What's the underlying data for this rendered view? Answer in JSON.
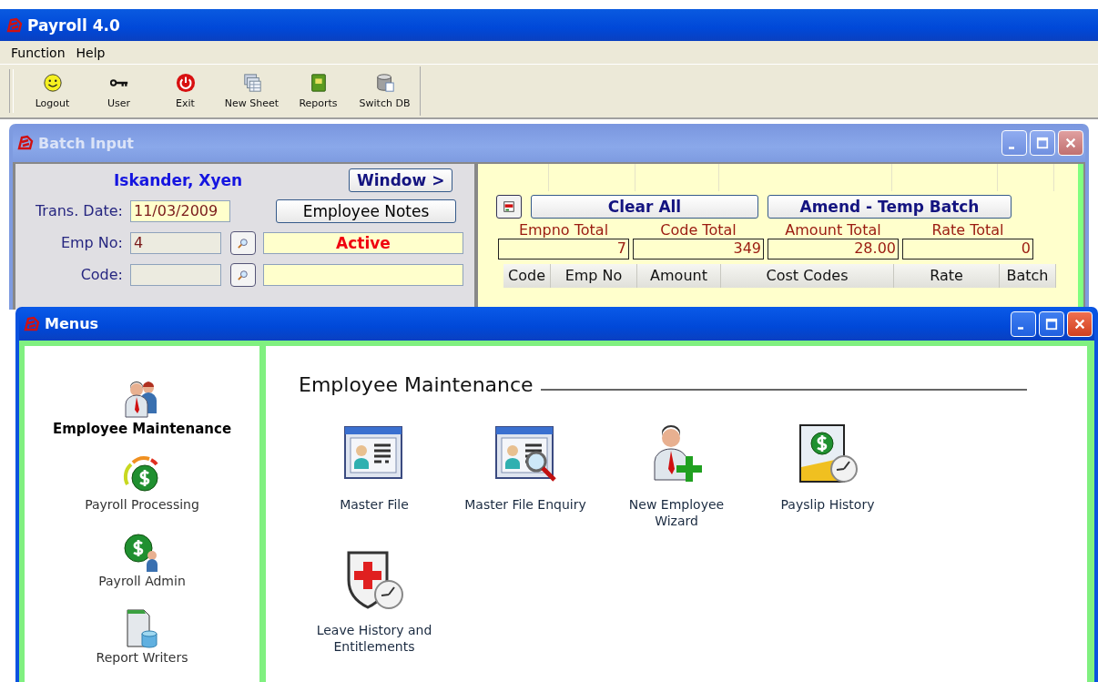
{
  "app": {
    "title": "Payroll 4.0"
  },
  "menu": [
    "Function",
    "Help"
  ],
  "toolbar": [
    {
      "label": "Logout",
      "kind": "smiley"
    },
    {
      "label": "User",
      "kind": "key"
    },
    {
      "label": "Exit",
      "kind": "power"
    },
    {
      "label": "New Sheet",
      "kind": "sheets"
    },
    {
      "label": "Reports",
      "kind": "book"
    },
    {
      "label": "Switch DB",
      "kind": "database"
    }
  ],
  "batch_window": {
    "title": "Batch Input",
    "employee_name": "Iskander, Xyen",
    "window_button": "Window >",
    "notes_button": "Employee Notes",
    "trans_date": {
      "label": "Trans. Date:",
      "value": "11/03/2009"
    },
    "emp_no": {
      "label": "Emp No:",
      "value": "4",
      "status": "Active"
    },
    "code": {
      "label": "Code:"
    },
    "clear_button": "Clear All",
    "amend_button": "Amend - Temp Batch",
    "totals": [
      {
        "label": "Empno Total",
        "value": "7"
      },
      {
        "label": "Code Total",
        "value": "349"
      },
      {
        "label": "Amount Total",
        "value": "28.00"
      },
      {
        "label": "Rate Total",
        "value": "0"
      }
    ],
    "columns": [
      "Code",
      "Emp No",
      "Amount",
      "Cost Codes",
      "Rate",
      "Batch"
    ]
  },
  "menus_window": {
    "title": "Menus",
    "sidebar": [
      {
        "label": "Employee Maintenance",
        "kind": "people",
        "selected": true
      },
      {
        "label": "Payroll Processing",
        "kind": "dollar-gauge",
        "selected": false
      },
      {
        "label": "Payroll Admin",
        "kind": "dollar-person",
        "selected": false
      },
      {
        "label": "Report Writers",
        "kind": "report",
        "selected": false
      }
    ],
    "section_title": "Employee Maintenance",
    "items": [
      {
        "label": "Master File",
        "kind": "card"
      },
      {
        "label": "Master File Enquiry",
        "kind": "card-search"
      },
      {
        "label": "New Employee Wizard",
        "kind": "person-add"
      },
      {
        "label": "Payslip History",
        "kind": "payslip"
      },
      {
        "label": "Leave History and Entitlements",
        "kind": "shield-clock"
      }
    ]
  }
}
